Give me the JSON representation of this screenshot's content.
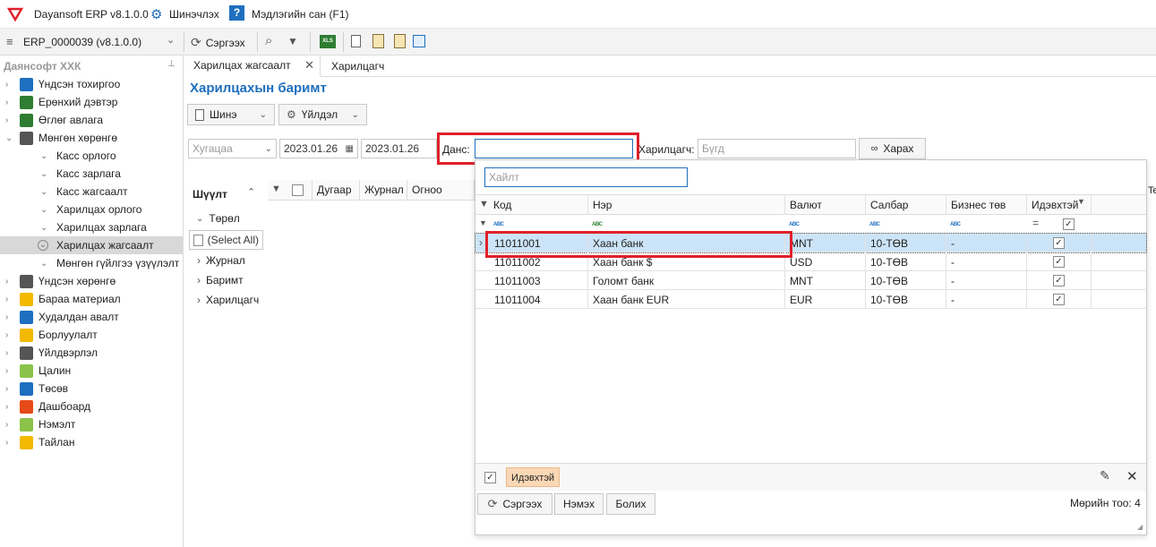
{
  "app": {
    "title": "Dayansoft ERP v8.1.0.0",
    "settings_label": "Шинэчлэх",
    "help_label": "Мэдлэгийн сан (F1)"
  },
  "toolbar": {
    "database": "ERP_0000039 (v8.1.0.0)",
    "refresh_label": "Сэргээх"
  },
  "sidebar": {
    "company": "Даянсофт ХХК",
    "items": [
      {
        "label": "Үндсэн тохиргоо",
        "icon": "settings-grid-icon",
        "color": "#1f6fbf"
      },
      {
        "label": "Ерөнхий дэвтэр",
        "icon": "ledger-book-icon",
        "color": "#2e7d32"
      },
      {
        "label": "Өглөг авлага",
        "icon": "dollar-doc-icon",
        "color": "#2e7d32"
      },
      {
        "label": "Мөнгөн хөрөнгө",
        "icon": "bank-icon",
        "color": "#555555"
      },
      {
        "label": "Касс орлого"
      },
      {
        "label": "Касс зарлага"
      },
      {
        "label": "Касс жагсаалт"
      },
      {
        "label": "Харилцах орлого"
      },
      {
        "label": "Харилцах зарлага"
      },
      {
        "label": "Харилцах жагсаалт"
      },
      {
        "label": "Мөнгөн гүйлгээ үзүүлэлт"
      },
      {
        "label": "Үндсэн хөрөнгө",
        "icon": "building-icon",
        "color": "#555555"
      },
      {
        "label": "Бараа материал",
        "icon": "box-icon",
        "color": "#f2b900"
      },
      {
        "label": "Худалдан авалт",
        "icon": "truck-icon",
        "color": "#1f6fbf"
      },
      {
        "label": "Борлуулалт",
        "icon": "cart-icon",
        "color": "#f2b900"
      },
      {
        "label": "Үйлдвэрлэл",
        "icon": "factory-icon",
        "color": "#555555"
      },
      {
        "label": "Цалин",
        "icon": "salary-icon",
        "color": "#8bc34a"
      },
      {
        "label": "Төсөв",
        "icon": "bar-chart-icon",
        "color": "#1f6fbf"
      },
      {
        "label": "Дашбоард",
        "icon": "pie-chart-icon",
        "color": "#e64a19"
      },
      {
        "label": "Нэмэлт",
        "icon": "addon-icon",
        "color": "#8bc34a"
      },
      {
        "label": "Тайлан",
        "icon": "clipboard-icon",
        "color": "#f2b900"
      }
    ]
  },
  "tabs": [
    {
      "label": "Харилцах жагсаалт"
    },
    {
      "label": "Харилцагч"
    }
  ],
  "page": {
    "title": "Харилцахын баримт",
    "new_label": "Шинэ",
    "action_label": "Үйлдэл",
    "period_placeholder": "Хугацаа",
    "date_from": "2023.01.26",
    "date_to": "2023.01.26",
    "account_label": "Данс:",
    "partner_label": "Харилцагч:",
    "partner_placeholder": "Бүгд",
    "search_label": "Харах"
  },
  "filter_panel": {
    "title": "Шүүлт",
    "type_label": "Төрөл",
    "select_all": "(Select All)",
    "groups": [
      "Журнал",
      "Баримт",
      "Харилцагч"
    ]
  },
  "main_grid": {
    "columns": [
      "Дугаар",
      "Журнал",
      "Огноо"
    ],
    "cut_off_column": "Te"
  },
  "popup": {
    "search_placeholder": "Хайлт",
    "columns": [
      "Код",
      "Нэр",
      "Валют",
      "Салбар",
      "Бизнес төв",
      "Идэвхтэй"
    ],
    "rows": [
      {
        "code": "11011001",
        "name": "Хаан банк",
        "currency": "MNT",
        "branch": "10-ТӨВ",
        "business": "-",
        "active": "✓"
      },
      {
        "code": "11011002",
        "name": "Хаан банк $",
        "currency": "USD",
        "branch": "10-ТӨВ",
        "business": "-",
        "active": "✓"
      },
      {
        "code": "11011003",
        "name": "Голомт банк",
        "currency": "MNT",
        "branch": "10-ТӨВ",
        "business": "-",
        "active": "✓"
      },
      {
        "code": "11011004",
        "name": "Хаан банк EUR",
        "currency": "EUR",
        "branch": "10-ТӨВ",
        "business": "-",
        "active": "✓"
      }
    ],
    "filter_tag": "Идэвхтэй",
    "refresh_label": "Сэргээх",
    "add_label": "Нэмэх",
    "cancel_label": "Болих",
    "row_count": "Мөрийн тоо: 4"
  }
}
